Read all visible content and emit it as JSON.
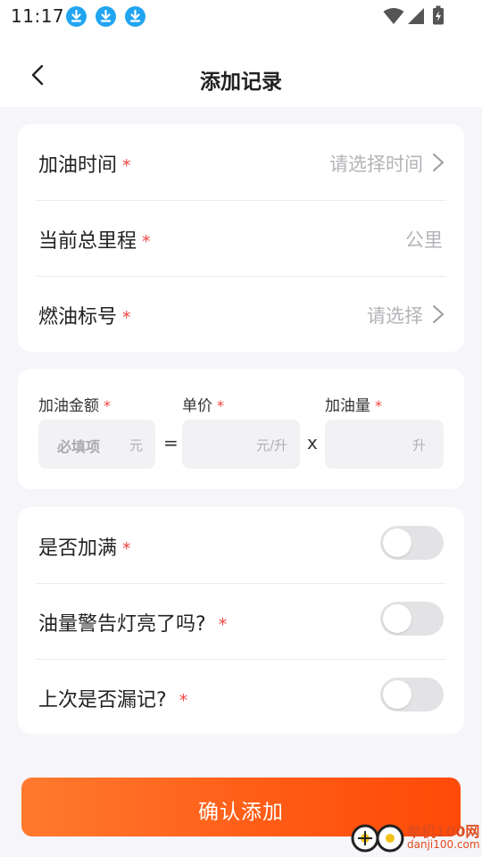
{
  "status_bar": {
    "time": "11:17",
    "notification_icons": [
      "download-icon",
      "download-icon",
      "download-icon"
    ],
    "system_icons": [
      "wifi-icon",
      "cell-signal-icon",
      "battery-charging-icon"
    ]
  },
  "header": {
    "title": "添加记录",
    "back_icon": "chevron-left-icon"
  },
  "basic_info": {
    "refuel_time": {
      "label": "加油时间",
      "required": "*",
      "placeholder": "请选择时间"
    },
    "odometer": {
      "label": "当前总里程",
      "required": "*",
      "unit": "公里"
    },
    "fuel_grade": {
      "label": "燃油标号",
      "required": "*",
      "placeholder": "请选择"
    }
  },
  "calculation": {
    "amount": {
      "label": "加油金额",
      "required": "*",
      "placeholder": "必填项",
      "unit": "元"
    },
    "equals": "=",
    "unit_price": {
      "label": "单价",
      "required": "*",
      "unit": "元/升"
    },
    "times": "x",
    "volume": {
      "label": "加油量",
      "required": "*",
      "unit": "升"
    }
  },
  "toggles": [
    {
      "label": "是否加满",
      "required": "*",
      "on": false
    },
    {
      "label": "油量警告灯亮了吗?",
      "required": "*",
      "on": false
    },
    {
      "label": "上次是否漏记?",
      "required": "*",
      "on": false
    }
  ],
  "confirm_button": {
    "label": "确认添加"
  },
  "watermark": {
    "line1": "单机100网",
    "line2": "danji100.com"
  },
  "colors": {
    "accent": "#ff5a14",
    "required": "#f24343",
    "background": "#f5f5fa",
    "status_icon": "#22a5f1",
    "toggle_off": "#e3e3e6"
  }
}
